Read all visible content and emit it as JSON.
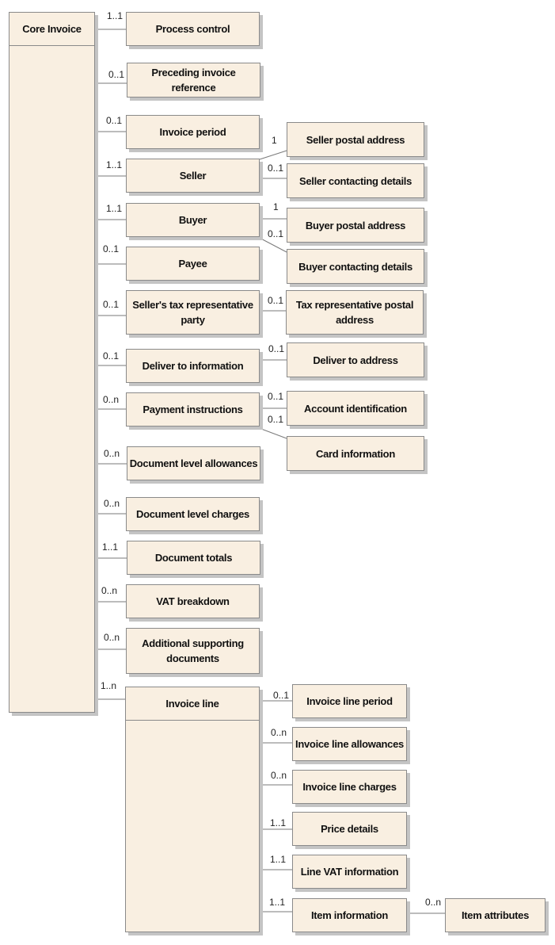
{
  "diagram": {
    "root": {
      "label": "Core Invoice"
    },
    "invoice_line_class": {
      "label": "Invoice line",
      "multiplicity": "1..n"
    },
    "core_children": [
      {
        "id": "process-control",
        "label": "Process control",
        "multiplicity": "1..1"
      },
      {
        "id": "preceding-invoice-reference",
        "label": "Preceding invoice reference",
        "multiplicity": "0..1"
      },
      {
        "id": "invoice-period",
        "label": "Invoice period",
        "multiplicity": "0..1"
      },
      {
        "id": "seller",
        "label": "Seller",
        "multiplicity": "1..1"
      },
      {
        "id": "buyer",
        "label": "Buyer",
        "multiplicity": "1..1"
      },
      {
        "id": "payee",
        "label": "Payee",
        "multiplicity": "0..1"
      },
      {
        "id": "sellers-tax-representative-party",
        "label": "Seller's tax representative party",
        "multiplicity": "0..1"
      },
      {
        "id": "deliver-to-information",
        "label": "Deliver to information",
        "multiplicity": "0..1"
      },
      {
        "id": "payment-instructions",
        "label": "Payment instructions",
        "multiplicity": "0..n"
      },
      {
        "id": "document-level-allowances",
        "label": "Document level allowances",
        "multiplicity": "0..n"
      },
      {
        "id": "document-level-charges",
        "label": "Document level charges",
        "multiplicity": "0..n"
      },
      {
        "id": "document-totals",
        "label": "Document totals",
        "multiplicity": "1..1"
      },
      {
        "id": "vat-breakdown",
        "label": "VAT breakdown",
        "multiplicity": "0..n"
      },
      {
        "id": "additional-supporting-documents",
        "label": "Additional supporting documents",
        "multiplicity": "0..n"
      }
    ],
    "sub_children": [
      {
        "id": "seller-postal-address",
        "parent": "seller",
        "label": "Seller postal address",
        "multiplicity": "1"
      },
      {
        "id": "seller-contacting-details",
        "parent": "seller",
        "label": "Seller contacting details",
        "multiplicity": "0..1"
      },
      {
        "id": "buyer-postal-address",
        "parent": "buyer",
        "label": "Buyer postal address",
        "multiplicity": "1"
      },
      {
        "id": "buyer-contacting-details",
        "parent": "buyer",
        "label": "Buyer contacting details",
        "multiplicity": "0..1"
      },
      {
        "id": "tax-representative-postal-address",
        "parent": "sellers-tax-representative-party",
        "label": "Tax representative postal address",
        "multiplicity": "0..1"
      },
      {
        "id": "deliver-to-address",
        "parent": "deliver-to-information",
        "label": "Deliver to address",
        "multiplicity": "0..1"
      },
      {
        "id": "account-identification",
        "parent": "payment-instructions",
        "label": "Account identification",
        "multiplicity": "0..1"
      },
      {
        "id": "card-information",
        "parent": "payment-instructions",
        "label": "Card information",
        "multiplicity": "0..1"
      }
    ],
    "line_children": [
      {
        "id": "invoice-line-period",
        "label": "Invoice line period",
        "multiplicity": "0..1"
      },
      {
        "id": "invoice-line-allowances",
        "label": "Invoice line allowances",
        "multiplicity": "0..n"
      },
      {
        "id": "invoice-line-charges",
        "label": "Invoice line charges",
        "multiplicity": "0..n"
      },
      {
        "id": "price-details",
        "label": "Price details",
        "multiplicity": "1..1"
      },
      {
        "id": "line-vat-information",
        "label": "Line VAT information",
        "multiplicity": "1..1"
      },
      {
        "id": "item-information",
        "label": "Item information",
        "multiplicity": "1..1"
      }
    ],
    "item_children": [
      {
        "id": "item-attributes",
        "parent": "item-information",
        "label": "Item attributes",
        "multiplicity": "0..n"
      }
    ],
    "colors": {
      "box_fill": "#f9efe1",
      "border": "#8a8a8a",
      "shadow": "#c4c4c4",
      "line": "#7a7a7a"
    }
  }
}
